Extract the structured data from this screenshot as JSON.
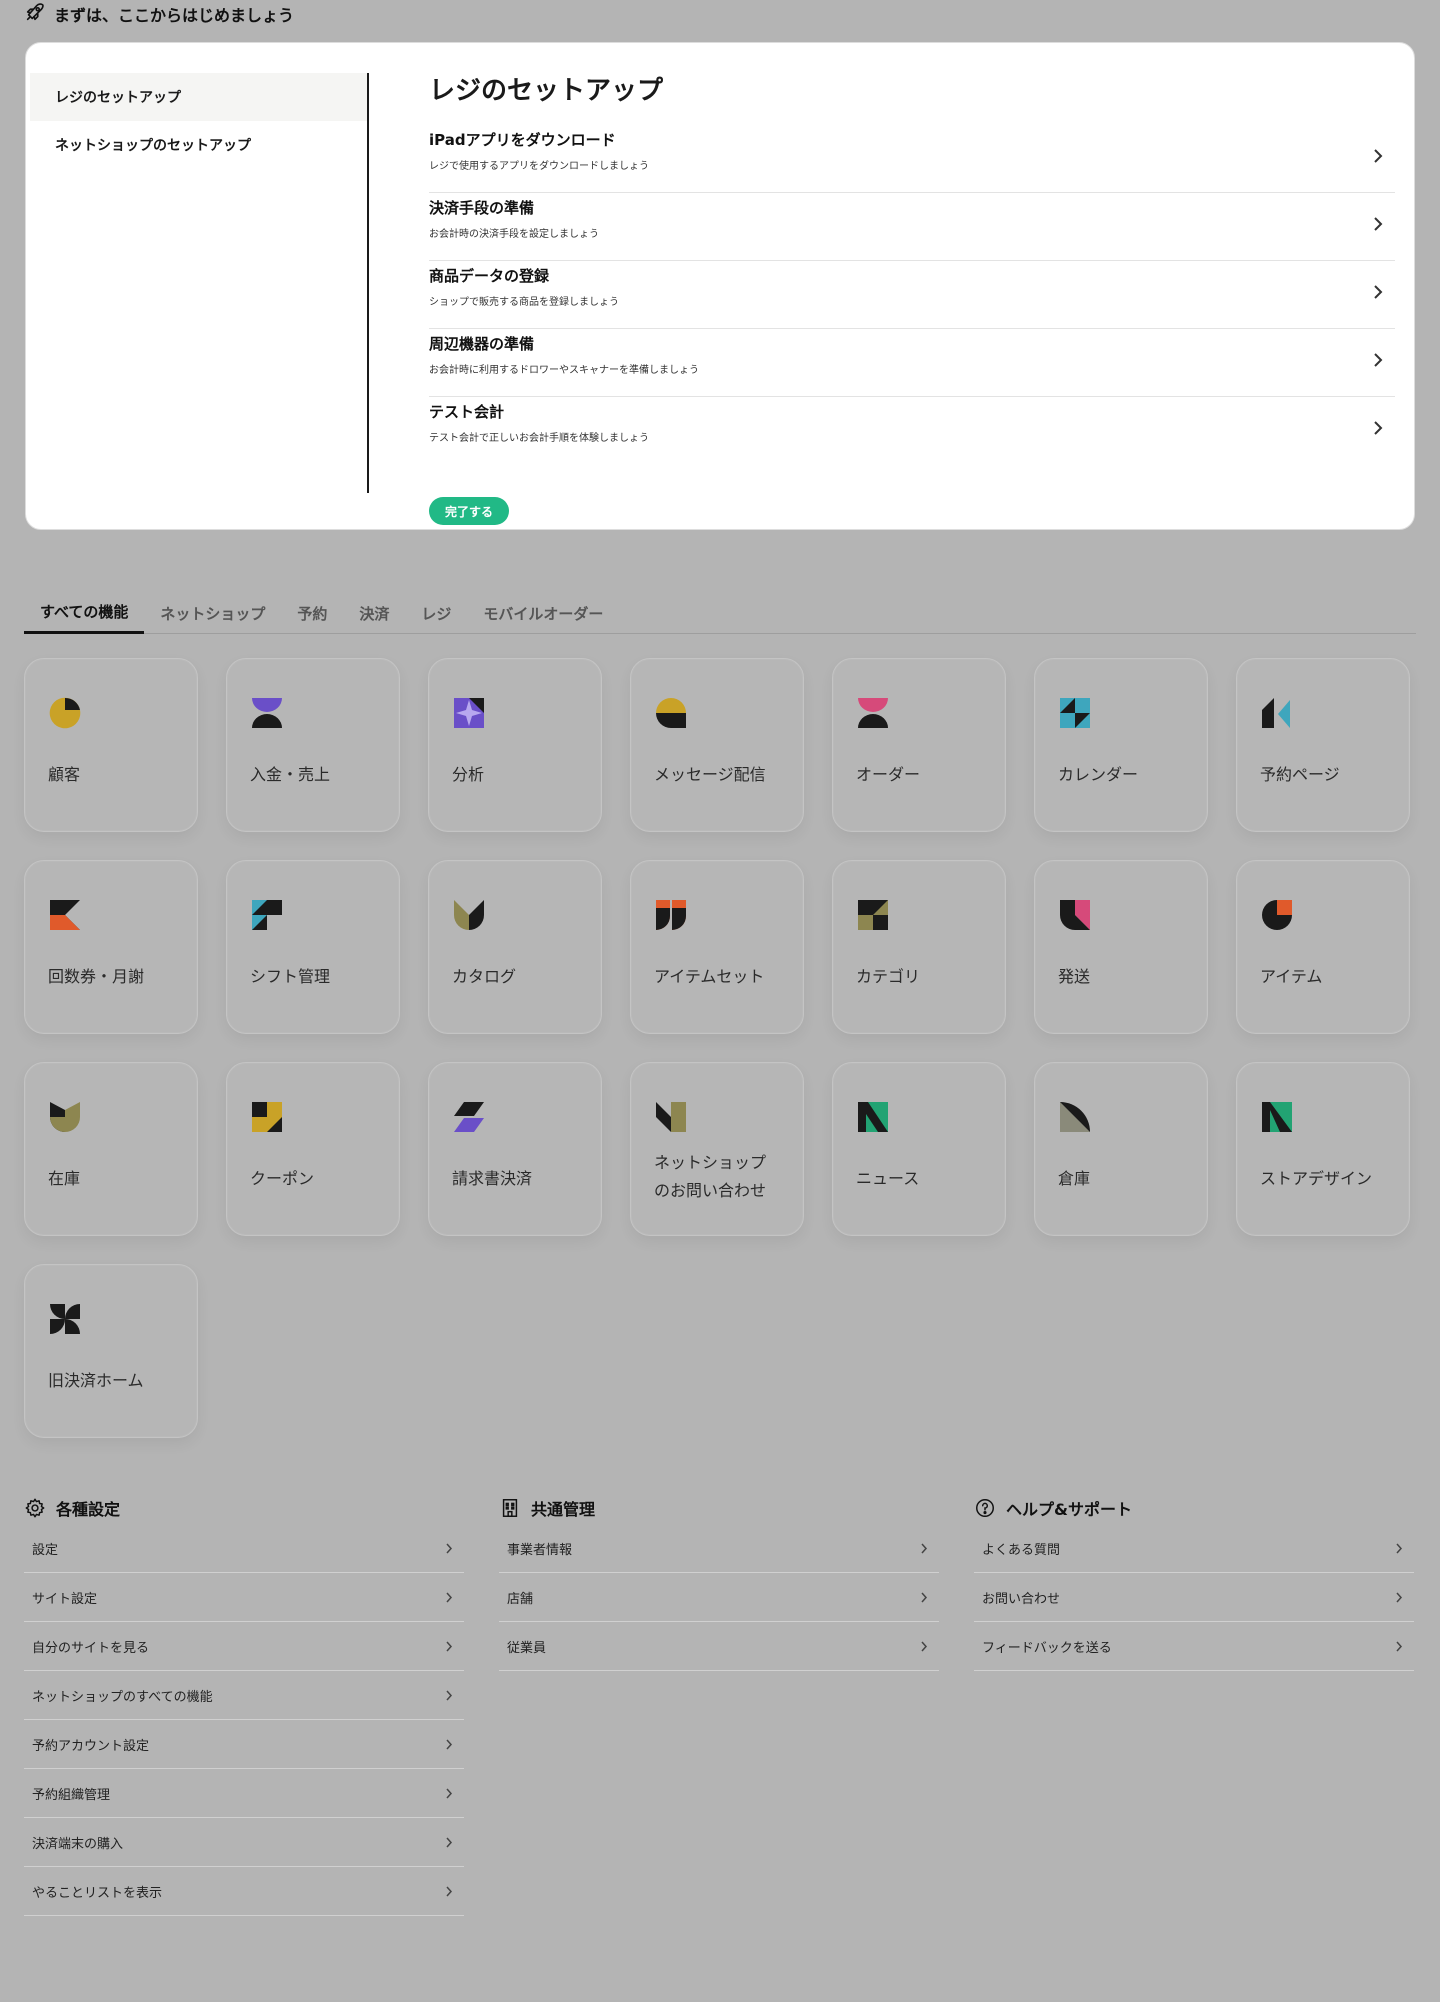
{
  "start": {
    "title": "まずは、ここからはじめましょう",
    "icon": "rocket-icon"
  },
  "setup": {
    "nav": [
      {
        "label": "レジのセットアップ",
        "active": true
      },
      {
        "label": "ネットショップのセットアップ",
        "active": false
      }
    ],
    "title": "レジのセットアップ",
    "steps": [
      {
        "title": "iPadアプリをダウンロード",
        "desc": "レジで使用するアプリをダウンロードしましょう"
      },
      {
        "title": "決済手段の準備",
        "desc": "お会計時の決済手段を設定しましょう"
      },
      {
        "title": "商品データの登録",
        "desc": "ショップで販売する商品を登録しましょう"
      },
      {
        "title": "周辺機器の準備",
        "desc": "お会計時に利用するドロワーやスキャナーを準備しましょう"
      },
      {
        "title": "テスト会計",
        "desc": "テスト会計で正しいお会計手順を体験しましょう"
      }
    ],
    "complete_label": "完了する",
    "accent": "#21b986"
  },
  "tabs": [
    {
      "label": "すべての機能",
      "active": true
    },
    {
      "label": "ネットショップ",
      "active": false
    },
    {
      "label": "予約",
      "active": false
    },
    {
      "label": "決済",
      "active": false
    },
    {
      "label": "レジ",
      "active": false
    },
    {
      "label": "モバイルオーダー",
      "active": false
    }
  ],
  "features": [
    {
      "label": "顧客",
      "icon": "customer-icon"
    },
    {
      "label": "入金・売上",
      "icon": "deposit-sales-icon"
    },
    {
      "label": "分析",
      "icon": "analytics-icon"
    },
    {
      "label": "メッセージ配信",
      "icon": "message-icon"
    },
    {
      "label": "オーダー",
      "icon": "order-icon"
    },
    {
      "label": "カレンダー",
      "icon": "calendar-icon"
    },
    {
      "label": "予約ページ",
      "icon": "reservation-page-icon"
    },
    {
      "label": "回数券・月謝",
      "icon": "ticket-icon"
    },
    {
      "label": "シフト管理",
      "icon": "shift-icon"
    },
    {
      "label": "カタログ",
      "icon": "catalog-icon"
    },
    {
      "label": "アイテムセット",
      "icon": "item-set-icon"
    },
    {
      "label": "カテゴリ",
      "icon": "category-icon"
    },
    {
      "label": "発送",
      "icon": "shipping-icon"
    },
    {
      "label": "アイテム",
      "icon": "item-icon"
    },
    {
      "label": "在庫",
      "icon": "inventory-icon"
    },
    {
      "label": "クーポン",
      "icon": "coupon-icon"
    },
    {
      "label": "請求書決済",
      "icon": "invoice-icon"
    },
    {
      "label": "ネットショップのお問い合わせ",
      "line1": "ネットショップ",
      "line2": "のお問い合わせ",
      "icon": "shop-inquiry-icon"
    },
    {
      "label": "ニュース",
      "icon": "news-icon"
    },
    {
      "label": "倉庫",
      "icon": "warehouse-icon"
    },
    {
      "label": "ストアデザイン",
      "icon": "store-design-icon"
    },
    {
      "label": "旧決済ホーム",
      "icon": "legacy-payment-icon"
    }
  ],
  "sections": [
    {
      "title": "各種設定",
      "icon": "gear-icon",
      "items": [
        "設定",
        "サイト設定",
        "自分のサイトを見る",
        "ネットショップのすべての機能",
        "予約アカウント設定",
        "予約組織管理",
        "決済端末の購入",
        "やることリストを表示"
      ]
    },
    {
      "title": "共通管理",
      "icon": "building-icon",
      "items": [
        "事業者情報",
        "店舗",
        "従業員"
      ]
    },
    {
      "title": "ヘルプ&サポート",
      "icon": "help-icon",
      "items": [
        "よくある質問",
        "お問い合わせ",
        "フィードバックを送る"
      ]
    }
  ]
}
